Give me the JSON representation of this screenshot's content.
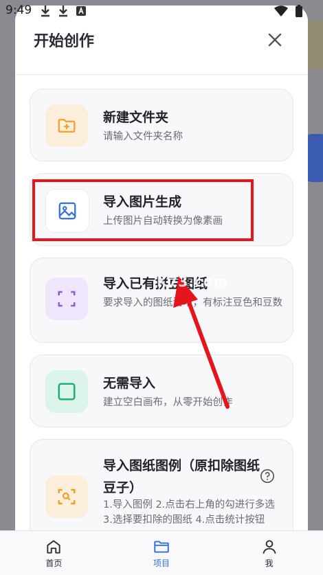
{
  "status": {
    "time": "9:49",
    "left_icons": [
      "download-icon",
      "download-icon",
      "a-badge-icon"
    ],
    "right_icons": [
      "wifi-icon",
      "battery-icon"
    ]
  },
  "sheet": {
    "title": "开始创作",
    "close_icon": "close-icon"
  },
  "options": [
    {
      "id": "new-folder",
      "title": "新建文件夹",
      "desc": "请输入文件夹名称",
      "icon": "folder-plus-icon",
      "icon_bg": "#fbefdc",
      "icon_color": "#f0a128"
    },
    {
      "id": "import-image",
      "title": "导入图片生成",
      "desc": "上传图片自动转换为像素画",
      "icon": "image-icon",
      "icon_bg": "#ffffff",
      "icon_color": "#2f6ee0"
    },
    {
      "id": "import-pattern",
      "title": "导入已有拼豆图纸",
      "desc": "要求导入的图纸清晰，有标注豆色和豆数",
      "icon": "scan-frame-icon",
      "icon_bg": "#efe6fb",
      "icon_color": "#8c5ae0"
    },
    {
      "id": "no-import",
      "title": "无需导入",
      "desc": "建立空白画布，从零开始创作",
      "icon": "square-icon",
      "icon_bg": "#ddf4ea",
      "icon_color": "#1fae77"
    },
    {
      "id": "import-example",
      "title": "导入图纸图例（原扣除图纸豆子）",
      "desc": "1.导入图例 2.点击右上角的勾进行多选 3.选择要扣除的图纸 4.点击统计按钮",
      "icon": "scan-search-icon",
      "icon_bg": "#fbefdc",
      "icon_color": "#f0a128"
    }
  ],
  "bottom_nav": [
    {
      "id": "home",
      "label": "首页",
      "icon": "home-icon"
    },
    {
      "id": "projects",
      "label": "项目",
      "icon": "folder-icon",
      "active": true
    },
    {
      "id": "me",
      "label": "我",
      "icon": "user-icon"
    }
  ],
  "overlay": {
    "watermark": "K73.com",
    "annotation_color": "#e5151d"
  }
}
